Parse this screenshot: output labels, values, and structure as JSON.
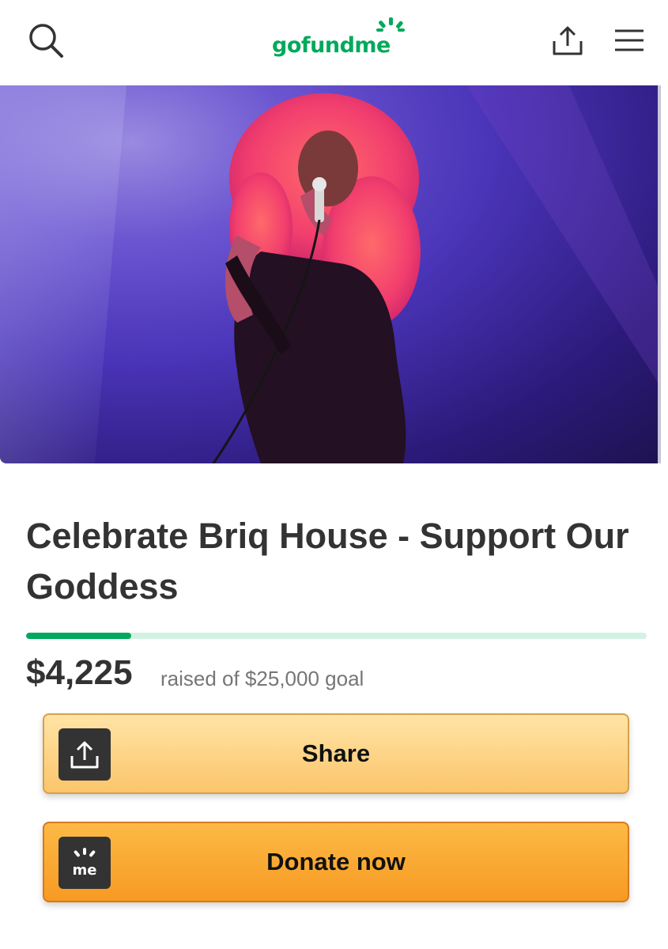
{
  "header": {
    "logo_text": "gofundme",
    "icons": [
      "search-icon",
      "share-icon",
      "hamburger-menu-icon"
    ]
  },
  "campaign": {
    "title": "Celebrate Briq House - Support Our Goddess",
    "raised": "$4,225",
    "goal_text": "raised of $25,000 goal",
    "progress_fraction": 0.169
  },
  "buttons": {
    "share_label": "Share",
    "donate_label": "Donate now",
    "donate_icon_text": "me"
  },
  "colors": {
    "brand_green": "#02a95c",
    "progress_track": "#d3f2e3",
    "share_bg": "#fbc56b",
    "donate_bg": "#f79a23"
  }
}
